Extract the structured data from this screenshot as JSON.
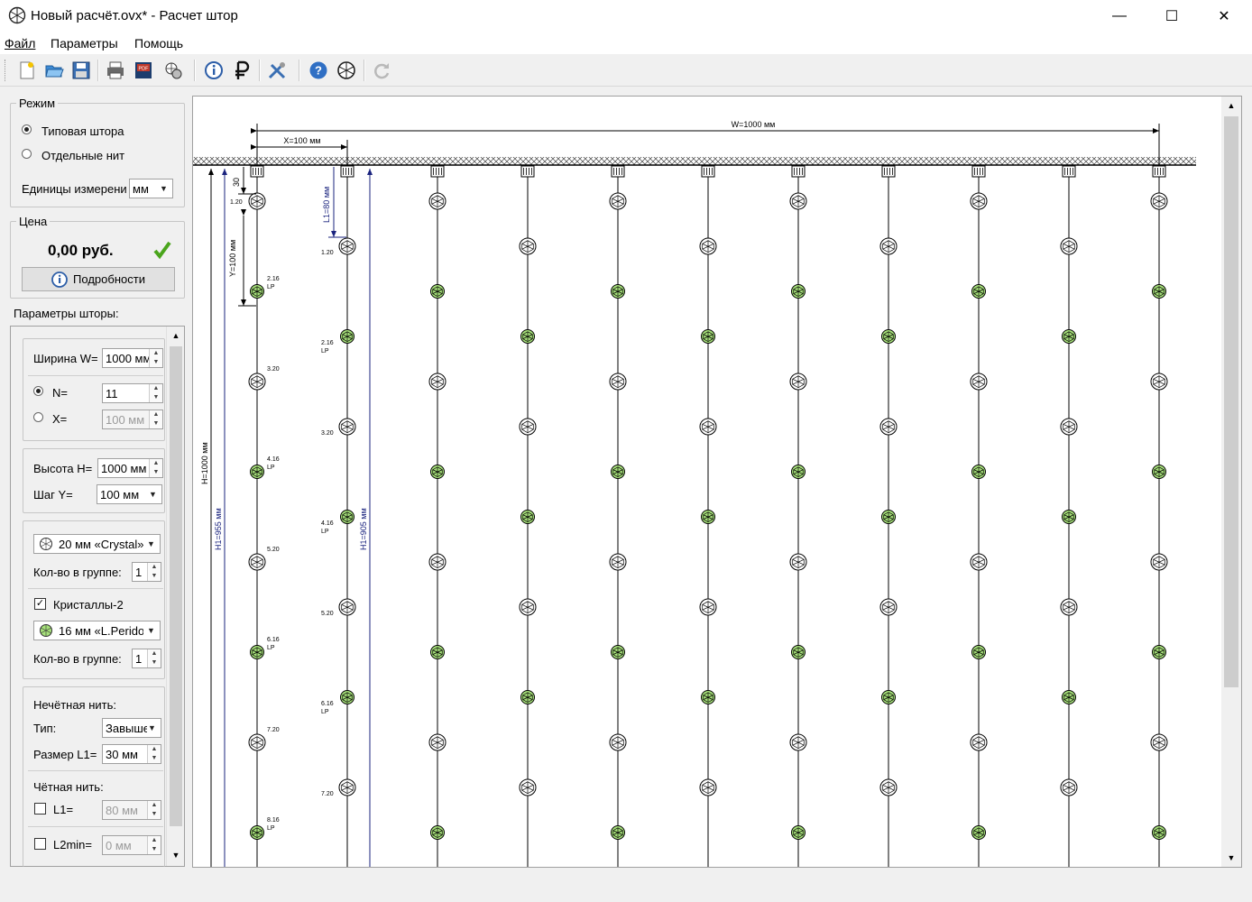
{
  "window": {
    "title": "Новый расчёт.ovx* - Расчет штор",
    "controls": [
      "—",
      "☐",
      "✕"
    ]
  },
  "menu": [
    "Файл",
    "Параметры",
    "Помощь"
  ],
  "toolbar": [
    "new-file-icon",
    "open-folder-icon",
    "save-icon",
    "print-icon",
    "pdf-icon",
    "beads-settings-icon",
    "info-icon",
    "ruble-icon",
    "tools-icon",
    "help-icon",
    "crystal-icon",
    "refresh-icon"
  ],
  "mode": {
    "legend": "Режим",
    "option1": "Типовая штора",
    "option2": "Отдельные нит",
    "units_label": "Единицы измерени",
    "units_value": "мм"
  },
  "price": {
    "legend": "Цена",
    "value": "0,00 руб.",
    "details_button": "Подробности"
  },
  "params": {
    "heading": "Параметры шторы:",
    "width_label": "Ширина W=",
    "width_value": "1000 мм",
    "n_label": "N=",
    "n_value": "11",
    "x_label": "X=",
    "x_value": "100 мм",
    "height_label": "Высота H=",
    "height_value": "1000 мм",
    "step_label": "Шаг Y=",
    "step_value": "100 мм",
    "crystal1": "20 мм «Crystal»",
    "qty_label1": "Кол-во в группе:",
    "qty_value1": "1",
    "crystals2_label": "Кристаллы-2",
    "crystal2": "16 мм «L.Peridot»",
    "qty_label2": "Кол-во в группе:",
    "qty_value2": "1",
    "odd_label": "Нечётная нить:",
    "type_label": "Тип:",
    "type_value": "Завыше",
    "size_label": "Размер L1=",
    "size_value": "30 мм",
    "even_label": "Чётная нить:",
    "l1_label": "L1=",
    "l1_value": "80 мм",
    "l2min_label": "L2min=",
    "l2min_value": "0 мм"
  },
  "drawing": {
    "width_dim": "W=1000 мм",
    "x_dim": "X=100 мм",
    "top_offset": "30",
    "y_dim": "Y=100 мм",
    "l1_dim": "L1=80 мм",
    "h_dim": "H=1000 мм",
    "h1_dim_left": "H1=955 мм",
    "h1_dim_right": "H1=905 мм",
    "bead_codes_odd": [
      "1.20",
      "2.16",
      "3.20",
      "4.16",
      "5.20",
      "6.16",
      "7.20",
      "8.16"
    ],
    "bead_codes_even": [
      "1.20",
      "2.16",
      "3.20",
      "4.16",
      "5.20",
      "6.16",
      "7.20"
    ],
    "lp": "LP",
    "colors": {
      "crystal_white": "#ffffff",
      "crystal_green": "#a6e07a",
      "dim_blue": "#1a237e"
    }
  }
}
